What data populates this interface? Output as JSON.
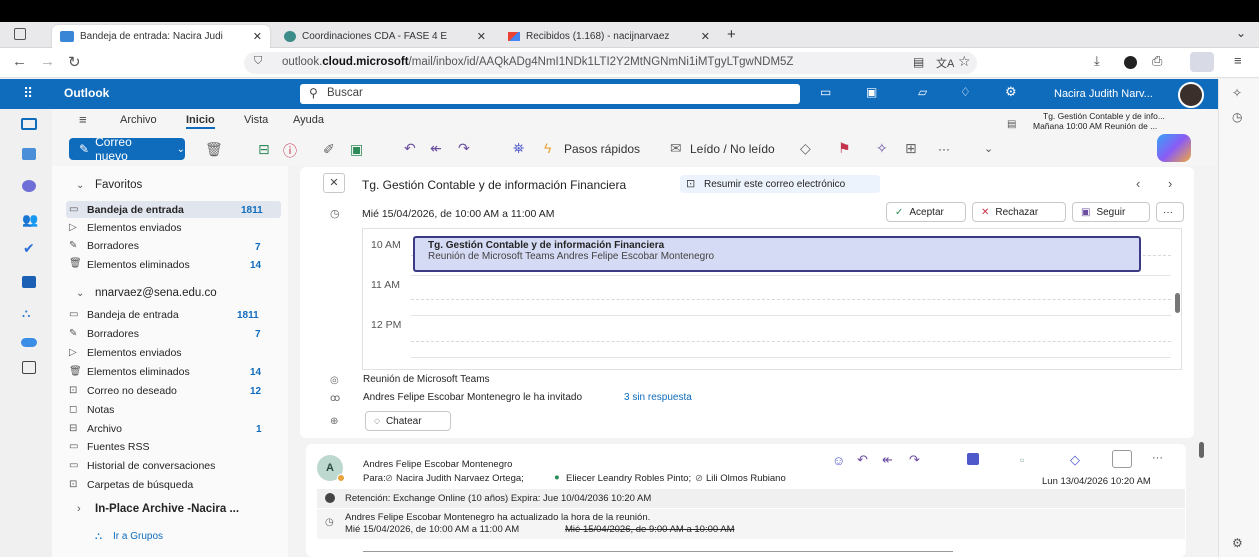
{
  "browser": {
    "tabs": [
      {
        "title": "Bandeja de entrada: Nacira Judi",
        "close": "✕",
        "active": true
      },
      {
        "title": "Coordinaciones CDA - FASE 4 E",
        "close": "✕",
        "active": false
      },
      {
        "title": "Recibidos (1.168) - nacijnarvaez",
        "close": "✕",
        "active": false
      }
    ],
    "new_tab": "+",
    "url_prefix": "outlook.",
    "url_domain": "cloud.microsoft",
    "url_path": "/mail/inbox/id/AAQkADg4NmI1NDk1LTI2Y2MtNGNmNi1iMTgyLTgwNDM5Z",
    "colors": {
      "tab_strip": "#e9e9ec",
      "active_tab": "#ffffff"
    }
  },
  "outlook": {
    "app_name": "Outlook",
    "search_placeholder": "Buscar",
    "user_name": "Nacira Judith Narv...",
    "accent": "#0f6cbd"
  },
  "ribbon": {
    "menus": [
      "Archivo",
      "Inicio",
      "Vista",
      "Ayuda"
    ],
    "active_menu": "Inicio",
    "new_mail": "Correo nuevo",
    "quick_steps": "Pasos rápidos",
    "read_unread": "Leído / No leído",
    "more": "···",
    "reminder": {
      "title": "Tg. Gestión Contable y de info...",
      "subtitle": "Mañana 10:00 AM Reunión de ..."
    }
  },
  "folders": {
    "favorites_header": "Favoritos",
    "favorites": [
      {
        "label": "Bandeja de entrada",
        "count": "1811",
        "icon": "inbox-icon"
      },
      {
        "label": "Elementos enviados",
        "count": "",
        "icon": "send-icon"
      },
      {
        "label": "Borradores",
        "count": "7",
        "icon": "draft-icon"
      },
      {
        "label": "Elementos eliminados",
        "count": "14",
        "icon": "trash-icon"
      }
    ],
    "account_header": "nnarvaez@sena.edu.co",
    "account": [
      {
        "label": "Bandeja de entrada",
        "count": "1811",
        "icon": "inbox-icon"
      },
      {
        "label": "Borradores",
        "count": "7",
        "icon": "draft-icon"
      },
      {
        "label": "Elementos enviados",
        "count": "",
        "icon": "send-icon"
      },
      {
        "label": "Elementos eliminados",
        "count": "14",
        "icon": "trash-icon"
      },
      {
        "label": "Correo no deseado",
        "count": "12",
        "icon": "junk-icon"
      },
      {
        "label": "Notas",
        "count": "",
        "icon": "note-icon"
      },
      {
        "label": "Archivo",
        "count": "1",
        "icon": "archive-icon"
      },
      {
        "label": "Fuentes RSS",
        "count": "",
        "icon": "rss-icon"
      },
      {
        "label": "Historial de conversaciones",
        "count": "",
        "icon": "folder-icon"
      },
      {
        "label": "Carpetas de búsqueda",
        "count": "",
        "icon": "search-folder-icon"
      }
    ],
    "archive_header": "In-Place Archive -Nacira ...",
    "groups_link": "Ir a Grupos"
  },
  "message": {
    "subject": "Tg. Gestión Contable y de información Financiera",
    "summarize": "Resumir este correo electrónico",
    "datetime": "Mié 15/04/2026, de 10:00 AM a 11:00 AM",
    "accept": "Aceptar",
    "decline": "Rechazar",
    "follow": "Seguir",
    "more": "···",
    "calendar_hours": [
      "10 AM",
      "11 AM",
      "12 PM"
    ],
    "event_title": "Tg. Gestión Contable y de información Financiera",
    "event_subtitle": "Reunión de Microsoft Teams Andres Felipe Escobar Montenegro",
    "meeting_type": "Reunión de Microsoft Teams",
    "invited_by": "Andres Felipe Escobar Montenegro le ha invitado",
    "no_response": "3 sin respuesta",
    "chat": "Chatear"
  },
  "message2": {
    "avatar_initial": "A",
    "sender": "Andres Felipe Escobar Montenegro",
    "to_label": "Para:",
    "recipients": [
      "Nacira Judith Narvaez Ortega;",
      "Eliecer Leandry Robles Pinto;",
      "Lili Olmos Rubiano"
    ],
    "date": "Lun 13/04/2026 10:20 AM",
    "retention": "Retención: Exchange Online (10 años) Expira: Jue 10/04/2036 10:20 AM",
    "update_line1": "Andres Felipe Escobar Montenegro ha actualizado la hora de la reunión.",
    "update_new": "Mié 15/04/2026, de 10:00 AM a 11:00 AM",
    "update_old": "Mié 15/04/2026, de 9:00 AM a 10:00 AM"
  }
}
